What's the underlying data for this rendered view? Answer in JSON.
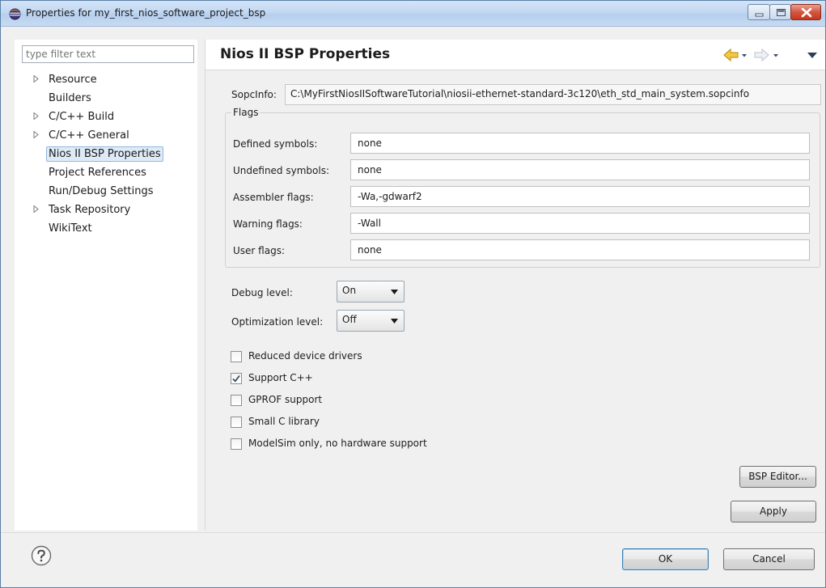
{
  "window": {
    "title": "Properties for my_first_nios_software_project_bsp"
  },
  "filter": {
    "placeholder": "type filter text"
  },
  "tree": {
    "items": [
      {
        "label": "Resource",
        "expandable": true
      },
      {
        "label": "Builders",
        "expandable": false
      },
      {
        "label": "C/C++ Build",
        "expandable": true
      },
      {
        "label": "C/C++ General",
        "expandable": true
      },
      {
        "label": "Nios II BSP Properties",
        "expandable": false,
        "selected": true
      },
      {
        "label": "Project References",
        "expandable": false
      },
      {
        "label": "Run/Debug Settings",
        "expandable": false
      },
      {
        "label": "Task Repository",
        "expandable": true
      },
      {
        "label": "WikiText",
        "expandable": false
      }
    ]
  },
  "page": {
    "title": "Nios II BSP Properties",
    "sopcinfo_label": "SopcInfo:",
    "sopcinfo_value": "C:\\MyFirstNiosIISoftwareTutorial\\niosii-ethernet-standard-3c120\\eth_std_main_system.sopcinfo"
  },
  "flags": {
    "legend": "Flags",
    "rows": [
      {
        "label": "Defined symbols:",
        "value": "none"
      },
      {
        "label": "Undefined symbols:",
        "value": "none"
      },
      {
        "label": "Assembler flags:",
        "value": "-Wa,-gdwarf2"
      },
      {
        "label": "Warning flags:",
        "value": "-Wall"
      },
      {
        "label": "User flags:",
        "value": "none"
      }
    ]
  },
  "levels": {
    "debug_label": "Debug level:",
    "debug_value": "On",
    "optimization_label": "Optimization level:",
    "optimization_value": "Off"
  },
  "options": [
    {
      "label": "Reduced device drivers",
      "checked": false
    },
    {
      "label": "Support C++",
      "checked": true
    },
    {
      "label": "GPROF support",
      "checked": false
    },
    {
      "label": "Small C library",
      "checked": false
    },
    {
      "label": "ModelSim only, no hardware support",
      "checked": false
    }
  ],
  "buttons": {
    "bsp_editor": "BSP Editor...",
    "apply": "Apply",
    "ok": "OK",
    "cancel": "Cancel"
  },
  "icons": {
    "window": "eclipse-icon",
    "help": "help-icon",
    "back": "back-arrow-icon",
    "forward": "forward-arrow-icon",
    "menu": "view-menu-icon"
  },
  "colors": {
    "back_arrow": "#e8b21c",
    "forward_arrow": "#b9c3cc",
    "selection": "#dfeaf7",
    "check": "#3b4c66"
  }
}
